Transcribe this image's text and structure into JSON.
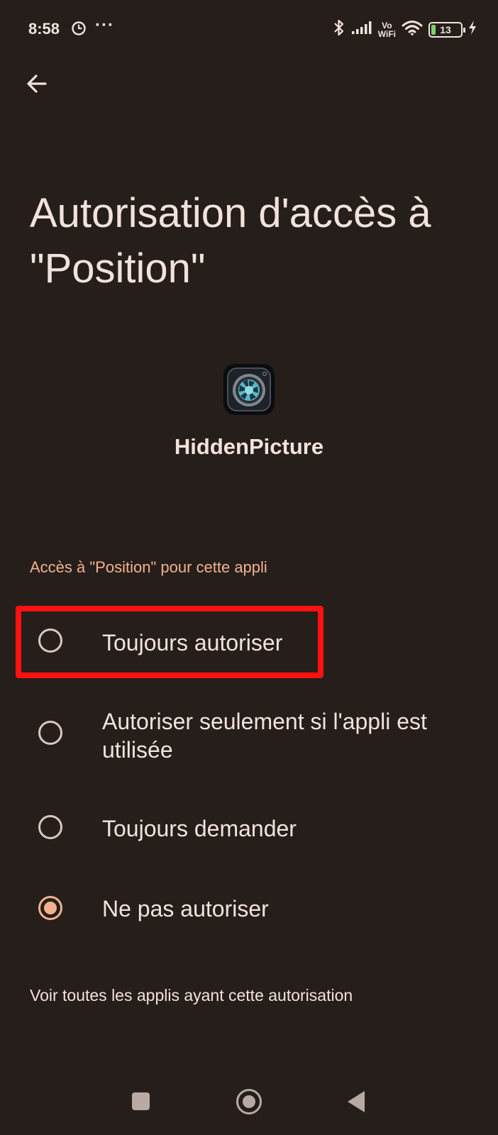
{
  "status_bar": {
    "time": "8:58",
    "more_indicator": "···",
    "network_label_top": "Vo",
    "network_label_bottom": "WiFi",
    "battery_level": "13",
    "icons": [
      "clock-icon",
      "bluetooth-icon",
      "signal-icon",
      "wifi-icon",
      "battery-icon",
      "charging-icon"
    ]
  },
  "header": {
    "back_icon": "arrow-left-icon",
    "title": "Autorisation d'accès à \"Position\""
  },
  "app": {
    "name": "HiddenPicture",
    "icon": "camera-aperture-icon"
  },
  "section": {
    "label": "Accès à \"Position\" pour cette appli"
  },
  "options": [
    {
      "label": "Toujours autoriser",
      "selected": false,
      "highlighted": true
    },
    {
      "label": "Autoriser seulement si l'appli est utilisée",
      "selected": false
    },
    {
      "label": "Toujours demander",
      "selected": false
    },
    {
      "label": "Ne pas autoriser",
      "selected": true
    }
  ],
  "footer": {
    "link": "Voir toutes les applis ayant cette autorisation"
  },
  "nav_bar": {
    "icons": [
      "recents-icon",
      "home-icon",
      "back-icon"
    ]
  },
  "colors": {
    "background": "#261e1b",
    "text": "#f1e3dc",
    "accent": "#f2b28e",
    "highlight": "#ff1111"
  }
}
